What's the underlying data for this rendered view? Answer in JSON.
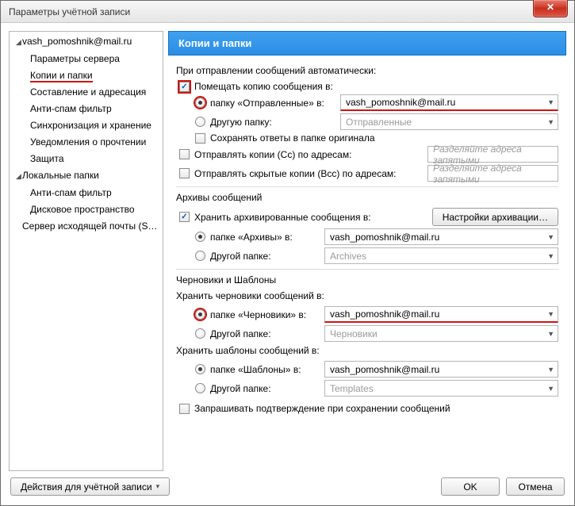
{
  "window": {
    "title": "Параметры учётной записи",
    "close_glyph": "✕"
  },
  "sidebar": {
    "account": "vash_pomoshnik@mail.ru",
    "items": [
      "Параметры сервера",
      "Копии и папки",
      "Составление и адресация",
      "Анти-спам фильтр",
      "Синхронизация и хранение",
      "Уведомления о прочтении",
      "Защита"
    ],
    "local": "Локальные папки",
    "local_items": [
      "Анти-спам фильтр",
      "Дисковое пространство"
    ],
    "outgoing": "Сервер исходящей почты (S…"
  },
  "main": {
    "header": "Копии и папки",
    "send_section": "При отправлении сообщений автоматически:",
    "place_copy": "Помещать копию сообщения в:",
    "sent_folder_label": "папку «Отправленные» в:",
    "sent_folder_value": "vash_pomoshnik@mail.ru",
    "other_folder_label": "Другую папку:",
    "other_folder_value": "Отправленные",
    "save_replies": "Сохранять ответы в папке оригинала",
    "cc_label": "Отправлять копии (Cc) по адресам:",
    "bcc_label": "Отправлять скрытые копии (Bcc) по адресам:",
    "addr_placeholder": "Разделяйте адреса запятыми",
    "archive_section": "Архивы сообщений",
    "archive_keep": "Хранить архивированные сообщения в:",
    "archive_settings_btn": "Настройки архивации…",
    "archive_folder_label": "папке «Архивы» в:",
    "archive_folder_value": "vash_pomoshnik@mail.ru",
    "archive_other_label": "Другой папке:",
    "archive_other_value": "Archives",
    "drafts_section": "Черновики и Шаблоны",
    "drafts_keep": "Хранить черновики сообщений в:",
    "drafts_folder_label": "папке «Черновики» в:",
    "drafts_folder_value": "vash_pomoshnik@mail.ru",
    "drafts_other_label": "Другой папке:",
    "drafts_other_value": "Черновики",
    "templates_keep": "Хранить шаблоны сообщений в:",
    "templates_folder_label": "папке «Шаблоны» в:",
    "templates_folder_value": "vash_pomoshnik@mail.ru",
    "templates_other_label": "Другой папке:",
    "templates_other_value": "Templates",
    "confirm_save": "Запрашивать подтверждение при сохранении сообщений"
  },
  "footer": {
    "account_actions": "Действия для учётной записи",
    "ok": "OK",
    "cancel": "Отмена"
  }
}
